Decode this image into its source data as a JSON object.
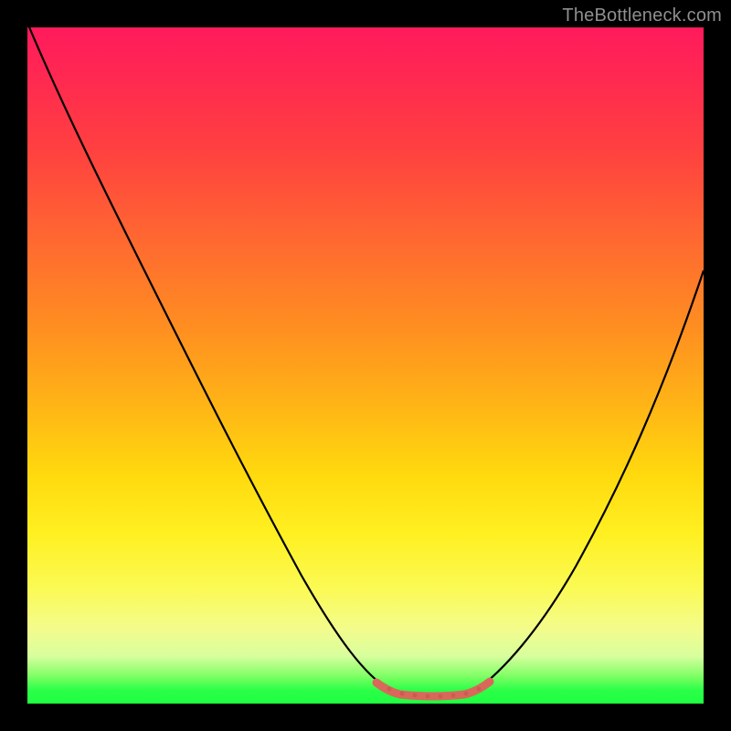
{
  "watermark": "TheBottleneck.com",
  "chart_data": {
    "type": "line",
    "title": "",
    "xlabel": "",
    "ylabel": "",
    "xlim": [
      0,
      1
    ],
    "ylim": [
      0,
      1
    ],
    "legend": false,
    "grid": false,
    "background_gradient": {
      "direction": "vertical",
      "stops": [
        {
          "pos": 0.0,
          "color": "#ff1a5c"
        },
        {
          "pos": 0.08,
          "color": "#ff2a50"
        },
        {
          "pos": 0.18,
          "color": "#ff4040"
        },
        {
          "pos": 0.32,
          "color": "#ff6a30"
        },
        {
          "pos": 0.45,
          "color": "#ff9020"
        },
        {
          "pos": 0.56,
          "color": "#ffb516"
        },
        {
          "pos": 0.66,
          "color": "#ffd90e"
        },
        {
          "pos": 0.75,
          "color": "#fff022"
        },
        {
          "pos": 0.83,
          "color": "#fbfa55"
        },
        {
          "pos": 0.89,
          "color": "#f3fc8c"
        },
        {
          "pos": 0.93,
          "color": "#d8fe9e"
        },
        {
          "pos": 0.96,
          "color": "#7dff64"
        },
        {
          "pos": 0.98,
          "color": "#2bff48"
        },
        {
          "pos": 1.0,
          "color": "#1fff41"
        }
      ]
    },
    "series": [
      {
        "name": "left-branch",
        "stroke": "#000000",
        "stroke_width": 2,
        "x": [
          0.0,
          0.06,
          0.12,
          0.18,
          0.24,
          0.3,
          0.36,
          0.42,
          0.48,
          0.51,
          0.54
        ],
        "y": [
          1.0,
          0.9,
          0.79,
          0.68,
          0.56,
          0.44,
          0.33,
          0.21,
          0.09,
          0.04,
          0.02
        ]
      },
      {
        "name": "right-branch",
        "stroke": "#000000",
        "stroke_width": 2,
        "x": [
          0.66,
          0.69,
          0.72,
          0.76,
          0.8,
          0.85,
          0.9,
          0.95,
          1.0
        ],
        "y": [
          0.02,
          0.04,
          0.08,
          0.14,
          0.22,
          0.32,
          0.42,
          0.53,
          0.64
        ]
      },
      {
        "name": "basin-highlight",
        "stroke": "#d9685a",
        "stroke_width": 8,
        "x": [
          0.51,
          0.54,
          0.58,
          0.62,
          0.66,
          0.69
        ],
        "y": [
          0.03,
          0.015,
          0.012,
          0.012,
          0.015,
          0.03
        ]
      }
    ],
    "minimum": {
      "x": 0.6,
      "y": 0.012
    }
  }
}
